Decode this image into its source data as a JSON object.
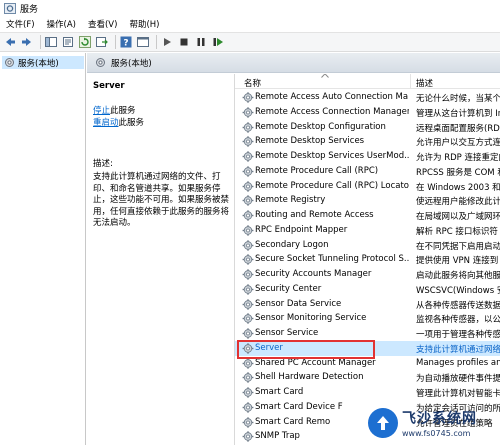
{
  "window": {
    "title": "服务"
  },
  "menubar": {
    "items": [
      "文件(F)",
      "操作(A)",
      "查看(V)",
      "帮助(H)"
    ]
  },
  "toolbar": {
    "icons": [
      "back-arrow-icon",
      "forward-arrow-icon",
      "show-tree-icon",
      "properties-icon",
      "refresh-icon",
      "export-icon",
      "help-icon",
      "console-icon",
      "play-icon",
      "stop-icon",
      "pause-icon",
      "restart-icon"
    ]
  },
  "tree": {
    "item_label": "服务(本地)"
  },
  "content_header": {
    "label": "服务(本地)"
  },
  "desc_pane": {
    "service_name": "Server",
    "stop_link": "停止",
    "stop_suffix": "此服务",
    "restart_link": "重启动",
    "restart_suffix": "此服务",
    "desc_label": "描述:",
    "desc_text": "支持此计算机通过网络的文件、打印、和命名管道共享。如果服务停止，这些功能不可用。如果服务被禁用，任何直接依赖于此服务的服务将无法启动。"
  },
  "list": {
    "col_name": "名称",
    "col_desc": "描述",
    "rows": [
      {
        "name": "Remote Access Auto Connection Ma...",
        "desc": "无论什么时候，当某个"
      },
      {
        "name": "Remote Access Connection Manager",
        "desc": "管理从这台计算机到 In"
      },
      {
        "name": "Remote Desktop Configuration",
        "desc": "远程桌面配置服务(RDC"
      },
      {
        "name": "Remote Desktop Services",
        "desc": "允许用户以交互方式连"
      },
      {
        "name": "Remote Desktop Services UserMod...",
        "desc": "允许为 RDP 连接重定向"
      },
      {
        "name": "Remote Procedure Call (RPC)",
        "desc": "RPCSS 服务是 COM 和"
      },
      {
        "name": "Remote Procedure Call (RPC) Locator",
        "desc": "在 Windows 2003 和"
      },
      {
        "name": "Remote Registry",
        "desc": "使远程用户能修改此计"
      },
      {
        "name": "Routing and Remote Access",
        "desc": "在局域网以及广域网环"
      },
      {
        "name": "RPC Endpoint Mapper",
        "desc": "解析 RPC 接口标识符"
      },
      {
        "name": "Secondary Logon",
        "desc": "在不同凭据下启用启动"
      },
      {
        "name": "Secure Socket Tunneling Protocol S...",
        "desc": "提供使用 VPN 连接到"
      },
      {
        "name": "Security Accounts Manager",
        "desc": "启动此服务将向其他服"
      },
      {
        "name": "Security Center",
        "desc": "WSCSVC(Windows 安"
      },
      {
        "name": "Sensor Data Service",
        "desc": "从各种传感器传送数据"
      },
      {
        "name": "Sensor Monitoring Service",
        "desc": "监视各种传感器，以公"
      },
      {
        "name": "Sensor Service",
        "desc": "一项用于管理各种传感"
      },
      {
        "name": "Server",
        "desc": "支持此计算机通过网络"
      },
      {
        "name": "Shared PC Account Manager",
        "desc": "Manages profiles an"
      },
      {
        "name": "Shell Hardware Detection",
        "desc": "为自动播放硬件事件提"
      },
      {
        "name": "Smart Card",
        "desc": "管理此计算机对智能卡"
      },
      {
        "name": "Smart Card Device F",
        "desc": "为给定会话可访问的所"
      },
      {
        "name": "Smart Card Remo",
        "desc": "允许管理员在组策略"
      },
      {
        "name": "SNMP Trap",
        "desc": ""
      }
    ],
    "selected_index": 17
  },
  "watermark": {
    "title": "飞沙系统网",
    "url": "www.fs0745.com"
  },
  "colors": {
    "selection": "#cce8ff",
    "link": "#0066cc",
    "highlight_border": "#e23232"
  }
}
